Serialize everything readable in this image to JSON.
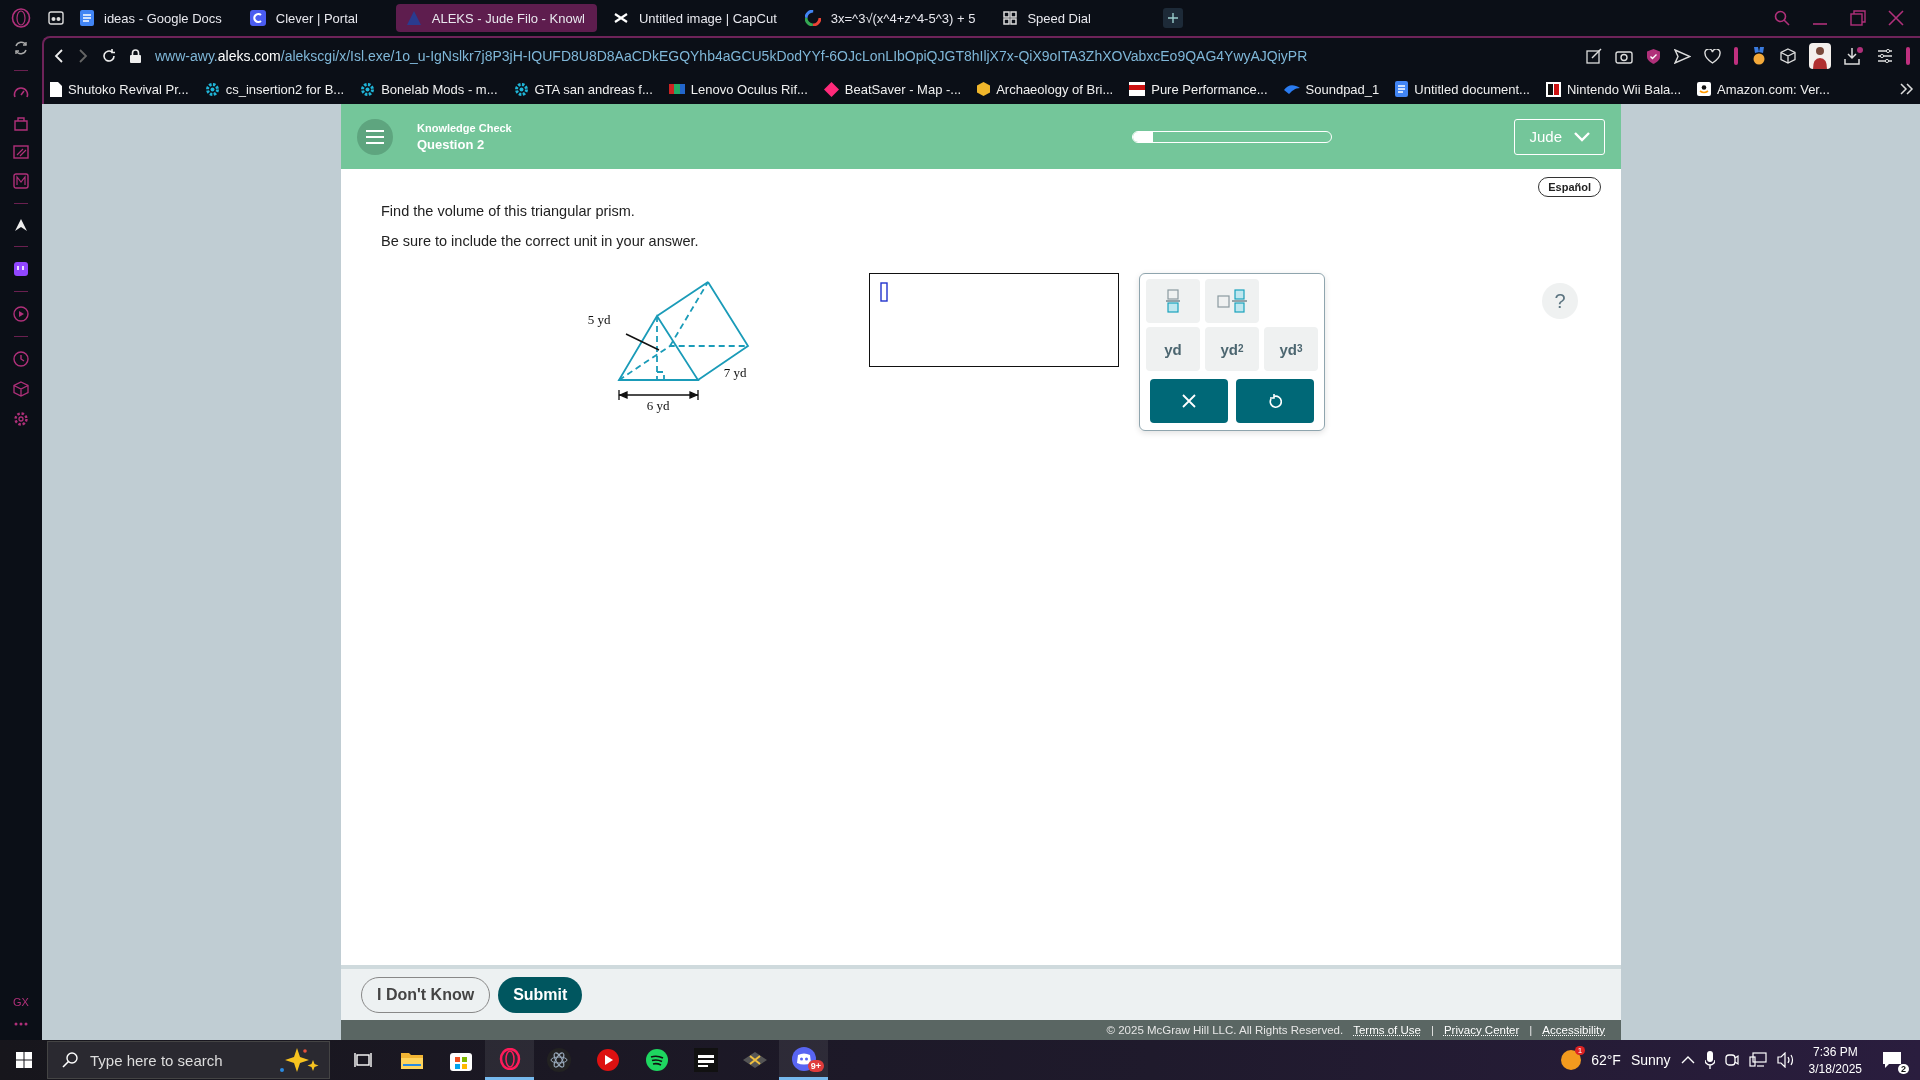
{
  "browser": {
    "tabs": [
      {
        "kind": "docs",
        "title": "ideas - Google Docs",
        "selected": false
      },
      {
        "kind": "clever",
        "title": "Clever | Portal",
        "selected": false
      },
      {
        "kind": "aleks",
        "title": "ALEKS - Jude Filo - Knowl",
        "selected": true
      },
      {
        "kind": "capcut",
        "title": "Untitled image | CapCut",
        "selected": false
      },
      {
        "kind": "google",
        "title": "3x=^3√(x^4+z^4-5^3) + 5",
        "selected": false
      },
      {
        "kind": "grid",
        "title": "Speed Dial",
        "selected": false
      }
    ],
    "address": "www-awy.**aleks.com**/alekscgi/x/Isl.exe/1o_u-IgNslkr7j8P3jH-IQUFD8U8D8AaCDkEGQYhb4aGCU5kDodYYf-6OJcLonLIbOpiQJGT8hIljX7x-QiX9oITA3ZhXOVabxcEo9QAG4YwyAJQiyPR",
    "bookmarks": [
      {
        "kind": "page",
        "title": "Shutoko Revival Pr..."
      },
      {
        "kind": "gear",
        "title": "cs_insertion2 for B..."
      },
      {
        "kind": "gear",
        "title": "Bonelab Mods - m..."
      },
      {
        "kind": "gear",
        "title": "GTA san andreas f..."
      },
      {
        "kind": "flag",
        "title": "Lenovo Oculus Rif..."
      },
      {
        "kind": "diamond",
        "title": "BeatSaver - Map -..."
      },
      {
        "kind": "hex",
        "title": "Archaeology of Bri..."
      },
      {
        "kind": "banner",
        "title": "Pure Performance..."
      },
      {
        "kind": "wave",
        "title": "Soundpad_1"
      },
      {
        "kind": "docs",
        "title": "Untitled document..."
      },
      {
        "kind": "tile",
        "title": "Nintendo Wii Bala..."
      },
      {
        "kind": "amazon",
        "title": "Amazon.com: Ver..."
      }
    ]
  },
  "sidebar": {
    "label": "GX"
  },
  "aleks": {
    "header": {
      "subtitle": "Knowledge Check",
      "title": "Question 2",
      "progress": {
        "level": 0.1
      },
      "user": "Jude"
    },
    "language": "Español",
    "question": [
      "Find the volume of this triangular prism.",
      "Be sure to include the correct unit in your answer."
    ],
    "figure": {
      "height_label": "5 yd",
      "length_label": "7 yd",
      "base_label": "6 yd"
    },
    "keypad": [
      {
        "kind": "fraction"
      },
      {
        "kind": "mixed"
      },
      {
        "kind": "blank"
      },
      {
        "kind": "unit",
        "label": "yd"
      },
      {
        "kind": "unit",
        "label": "yd$^{2}$"
      },
      {
        "kind": "unit",
        "label": "yd$^{3}$"
      },
      {
        "kind": "clear"
      },
      {
        "kind": "undo"
      }
    ],
    "help": "?",
    "buttons": [
      {
        "kind": "secondary",
        "label": "I Don't Know"
      },
      {
        "kind": "primary",
        "label": "Submit"
      }
    ],
    "footer": {
      "copyright": "© 2025 McGraw Hill LLC. All Rights Reserved.",
      "links": [
        "Terms of Use",
        "Privacy Center",
        "Accessibility"
      ],
      "separator": "|"
    }
  },
  "taskbar": {
    "search": "Type here to search",
    "apps": [
      {
        "kind": "taskview",
        "open": false
      },
      {
        "kind": "explorer",
        "open": false
      },
      {
        "kind": "store",
        "open": false
      },
      {
        "kind": "opera",
        "open": true
      },
      {
        "kind": "atom",
        "open": false
      },
      {
        "kind": "youtube",
        "open": false
      },
      {
        "kind": "spotify",
        "open": false
      },
      {
        "kind": "game",
        "open": false
      },
      {
        "kind": "xbox",
        "open": false
      },
      {
        "kind": "discord",
        "open": true,
        "badge": "9+"
      }
    ],
    "weather": {
      "badge": "1",
      "temperature": "62°F",
      "condition": "Sunny"
    },
    "time": "7:36 PM",
    "date": "3/18/2025",
    "notifications": "2"
  }
}
